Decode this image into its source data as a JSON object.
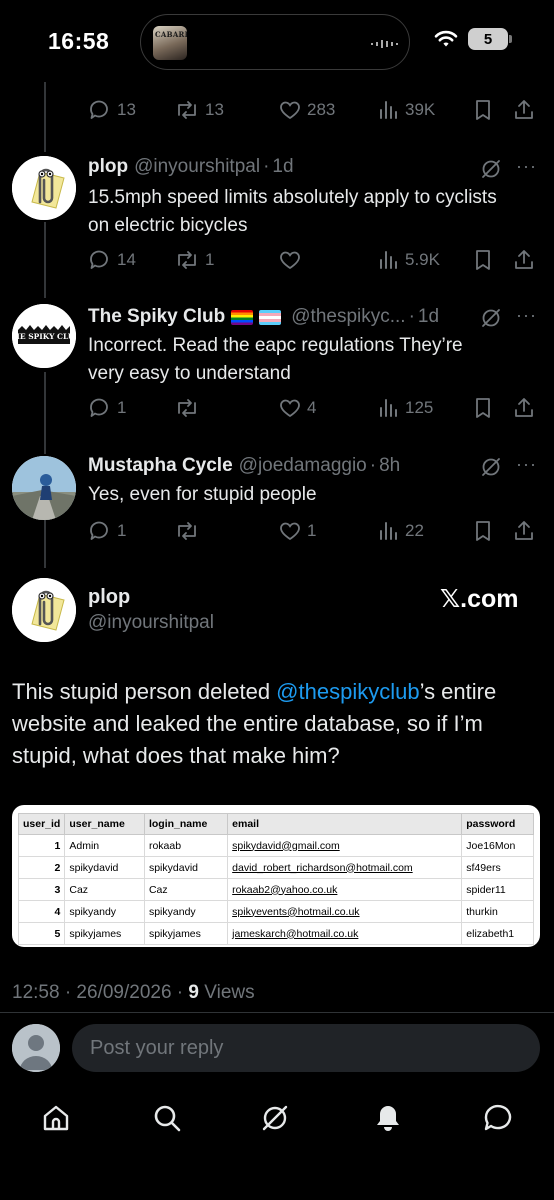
{
  "status_bar": {
    "time": "16:58",
    "album_art_text": "CABARET",
    "battery": "5"
  },
  "top_tweet_actions": {
    "replies": "13",
    "reposts": "13",
    "likes": "283",
    "views": "39K"
  },
  "thread": [
    {
      "display_name": "plop",
      "handle": "@inyourshitpal",
      "time": "1d",
      "text": "15.5mph speed limits absolutely apply to cyclists on electric bicycles",
      "replies": "14",
      "reposts": "1",
      "likes": "",
      "views": "5.9K"
    },
    {
      "display_name": "The Spiky Club",
      "handle": "@thespikyc...",
      "time": "1d",
      "avatar_text": "THE SPIKY CLUB",
      "text": "Incorrect.  Read the  eapc regulations They’re very easy to understand",
      "replies": "1",
      "reposts": "",
      "likes": "4",
      "views": "125"
    },
    {
      "display_name": "Mustapha Cycle",
      "handle": "@joedamaggio",
      "time": "8h",
      "text": "Yes, even for stupid people",
      "replies": "1",
      "reposts": "",
      "likes": "1",
      "views": "22"
    }
  ],
  "main_tweet": {
    "display_name": "plop",
    "handle": "@inyourshitpal",
    "brand": "𝕏.com",
    "text_before": "This stupid person deleted ",
    "mention": "@thespikyclub",
    "text_after": "’s entire website and leaked the entire database, so if I’m stupid, what does that make him?",
    "timestamp": "12:58 · 26/09/2026 · ",
    "views_count": "9",
    "views_label": " Views"
  },
  "db_table": {
    "columns": [
      "user_id",
      "user_name",
      "login_name",
      "email",
      "password"
    ],
    "rows": [
      [
        "1",
        "Admin",
        "rokaab",
        "spikydavid@gmail.com",
        "Joe16Mon"
      ],
      [
        "2",
        "spikydavid",
        "spikydavid",
        "david_robert_richardson@hotmail.com",
        "sf49ers"
      ],
      [
        "3",
        "Caz",
        "Caz",
        "rokaab2@yahoo.co.uk",
        "spider11"
      ],
      [
        "4",
        "spikyandy",
        "spikyandy",
        "spikyevents@hotmail.co.uk",
        "thurkin"
      ],
      [
        "5",
        "spikyjames",
        "spikyjames",
        "jameskarch@hotmail.co.uk",
        "elizabeth1"
      ]
    ]
  },
  "reply": {
    "placeholder": "Post your reply"
  },
  "nav": [
    "home-icon",
    "search-icon",
    "grok-icon",
    "notifications-icon",
    "messages-icon"
  ]
}
